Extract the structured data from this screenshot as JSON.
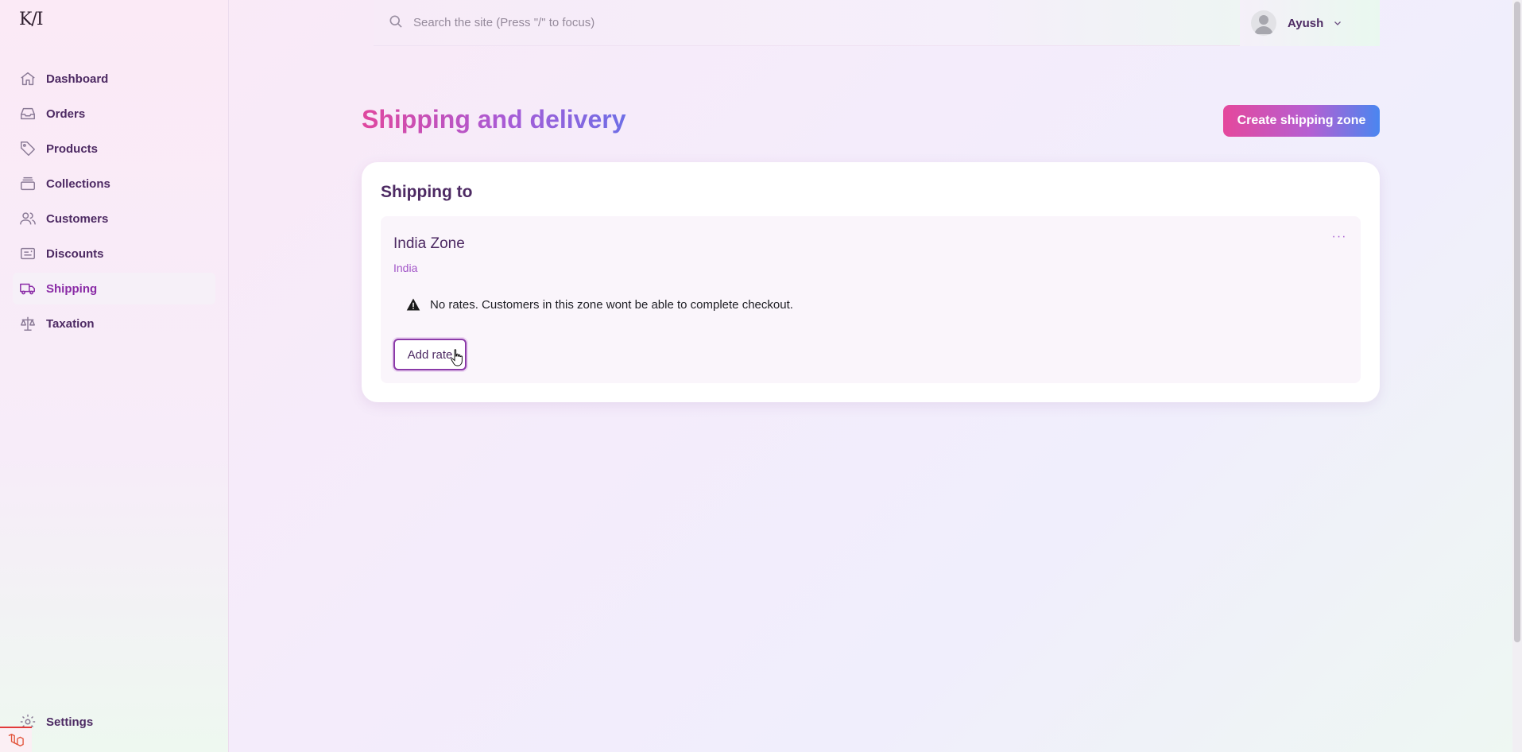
{
  "app": {
    "logo": "K/I"
  },
  "sidebar": {
    "items": [
      {
        "label": "Dashboard",
        "icon": "home-icon"
      },
      {
        "label": "Orders",
        "icon": "inbox-icon"
      },
      {
        "label": "Products",
        "icon": "tag-icon"
      },
      {
        "label": "Collections",
        "icon": "stack-icon"
      },
      {
        "label": "Customers",
        "icon": "users-icon"
      },
      {
        "label": "Discounts",
        "icon": "ticket-icon"
      },
      {
        "label": "Shipping",
        "icon": "truck-icon",
        "active": true
      },
      {
        "label": "Taxation",
        "icon": "scale-icon"
      }
    ],
    "settings": {
      "label": "Settings",
      "icon": "gear-icon"
    }
  },
  "search": {
    "placeholder": "Search the site (Press \"/\" to focus)"
  },
  "user": {
    "name": "Ayush"
  },
  "page": {
    "title": "Shipping and delivery",
    "create_label": "Create shipping zone"
  },
  "card": {
    "title": "Shipping to",
    "zone": {
      "name": "India Zone",
      "country": "India",
      "more_label": "···",
      "warning": "No rates. Customers in this zone wont be able to complete checkout.",
      "add_rate_label": "Add rate"
    }
  },
  "colors": {
    "accent": "#a855c8",
    "title_gradient": [
      "#e0479e",
      "#6e6ee6"
    ],
    "button_gradient": [
      "#e5489c",
      "#4a86f0"
    ],
    "nav_text": "#4d2a63"
  }
}
